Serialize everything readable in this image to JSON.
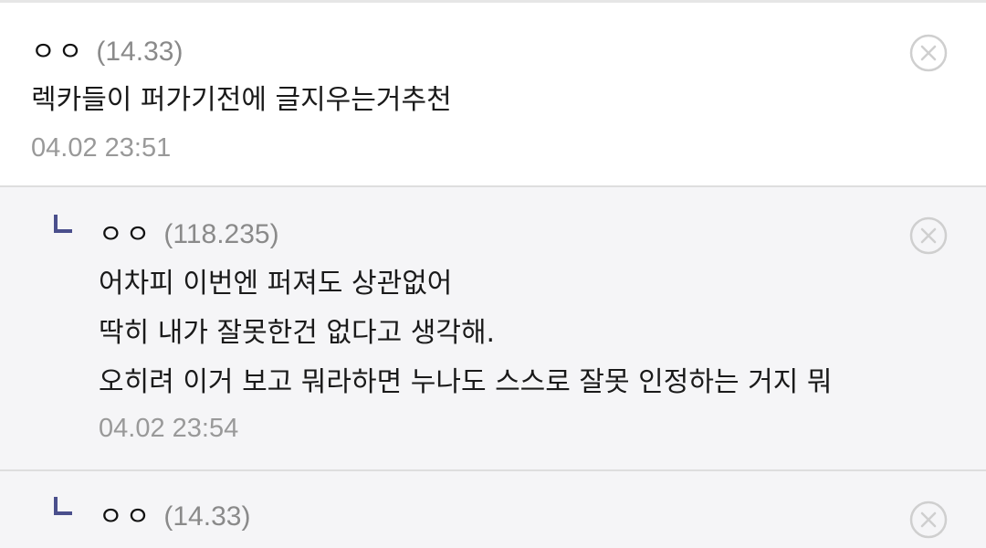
{
  "comments": [
    {
      "nickname": "ㅇㅇ",
      "ip": "(14.33)",
      "lines": [
        "렉카들이 퍼가기전에 글지우는거추천"
      ],
      "time": "04.02 23:51"
    },
    {
      "nickname": "ㅇㅇ",
      "ip": "(118.235)",
      "lines": [
        "어차피 이번엔 퍼져도 상관없어",
        "딱히 내가 잘못한건 없다고 생각해.",
        "오히려 이거 보고 뭐라하면 누나도 스스로 잘못 인정하는 거지 뭐"
      ],
      "time": "04.02 23:54"
    },
    {
      "nickname": "ㅇㅇ",
      "ip": "(14.33)"
    }
  ],
  "icons": {
    "delete": "circle-x-icon",
    "reply": "reply-arrow-icon"
  },
  "colors": {
    "reply_marker": "#4a4f8c",
    "reply_background": "#f5f5f7",
    "meta_text": "#999999"
  }
}
